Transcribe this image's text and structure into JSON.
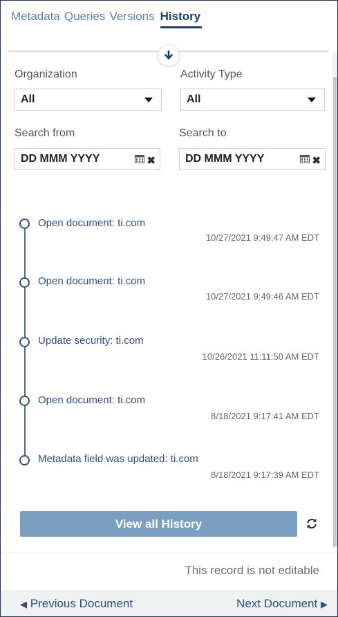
{
  "tabs": [
    {
      "label": "Metadata"
    },
    {
      "label": "Queries"
    },
    {
      "label": "Versions"
    },
    {
      "label": "History"
    }
  ],
  "filters": {
    "organization_label": "Organization",
    "organization_value": "All",
    "activity_label": "Activity Type",
    "activity_value": "All",
    "search_from_label": "Search from",
    "search_from_value": "DD MMM YYYY",
    "search_to_label": "Search to",
    "search_to_value": "DD MMM YYYY"
  },
  "history": [
    {
      "title": "Open document: ti.com",
      "time": "10/27/2021 9:49:47 AM EDT"
    },
    {
      "title": "Open document: ti.com",
      "time": "10/27/2021 9:49:46 AM EDT"
    },
    {
      "title": "Update security: ti.com",
      "time": "10/26/2021 11:11:50 AM EDT"
    },
    {
      "title": "Open document: ti.com",
      "time": "8/18/2021 9:17:41 AM EDT"
    },
    {
      "title": "Metadata field was updated: ti.com",
      "time": "8/18/2021 9:17:39 AM EDT"
    }
  ],
  "buttons": {
    "view_all": "View all History"
  },
  "status": {
    "not_editable": "This record is not editable"
  },
  "footer": {
    "prev": "Previous Document",
    "next": "Next Document"
  },
  "colors": {
    "accent": "#1e3d6b",
    "link": "#2c4f80",
    "button": "#7a9fc1"
  }
}
